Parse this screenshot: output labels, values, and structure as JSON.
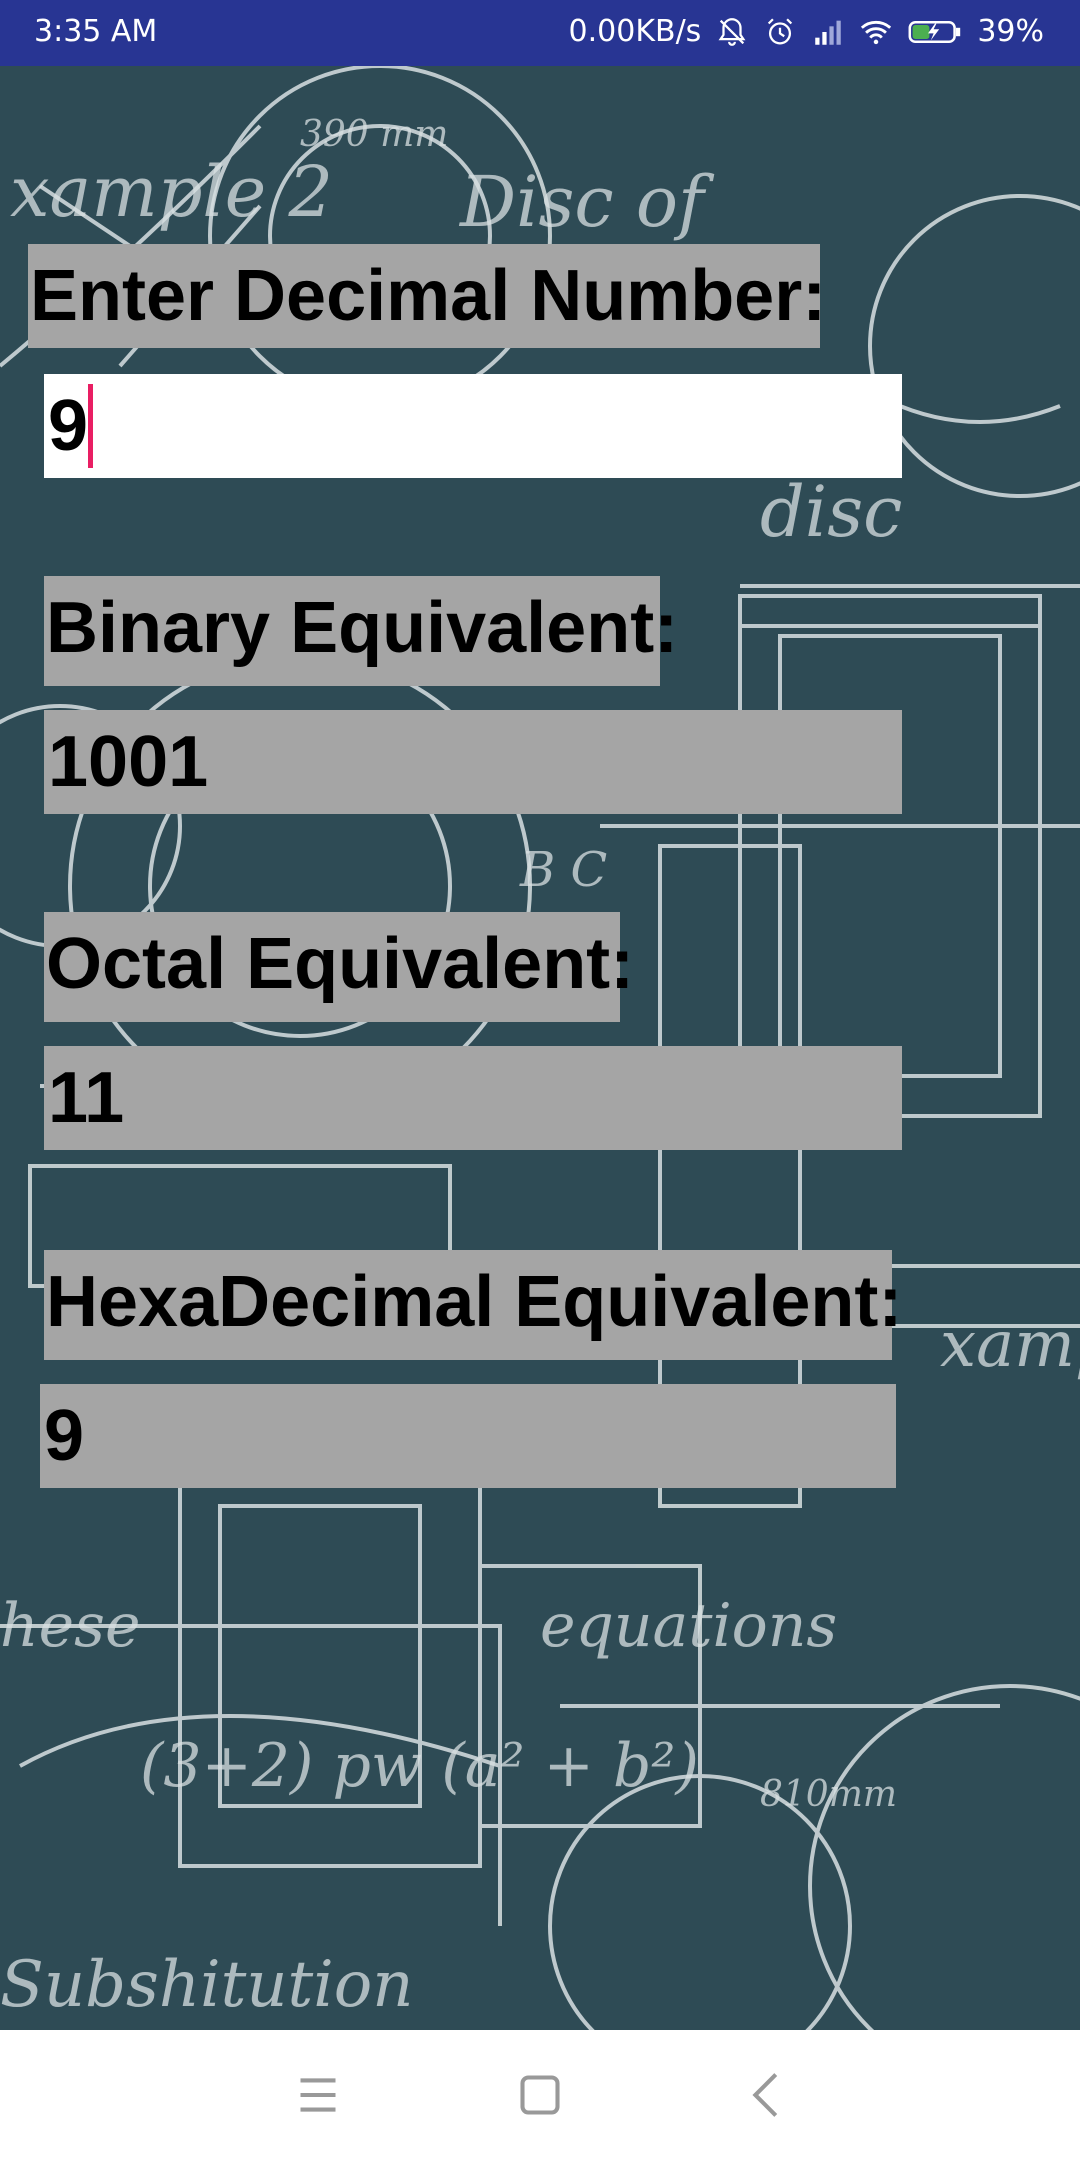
{
  "status_bar": {
    "time": "3:35 AM",
    "network_speed": "0.00KB/s",
    "battery": "39%",
    "icons": [
      "bell-off-icon",
      "alarm-icon",
      "signal-icon",
      "wifi-icon",
      "battery-charging-icon"
    ]
  },
  "form": {
    "decimal_label": "Enter Decimal Number:",
    "decimal_value": "9",
    "binary_label": "Binary Equivalent:",
    "binary_value": "1001",
    "octal_label": "Octal Equivalent:",
    "octal_value": "11",
    "hex_label": "HexaDecimal Equivalent:",
    "hex_value": "9"
  },
  "navigation": {
    "icons": [
      "menu-icon",
      "home-icon",
      "back-icon"
    ]
  },
  "colors": {
    "status_bar": "#283593",
    "background": "#2e4b55",
    "label_bg": "#a5a5a5",
    "cursor": "#e91e63"
  }
}
